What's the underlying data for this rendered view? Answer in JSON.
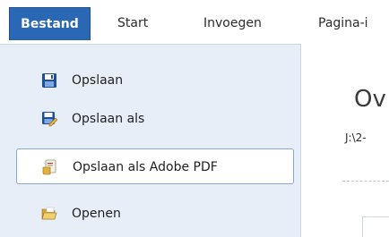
{
  "ribbon": {
    "tabs": {
      "file": "Bestand",
      "start": "Start",
      "insert": "Invoegen",
      "page_layout": "Pagina-i"
    }
  },
  "file_menu": {
    "items": [
      {
        "label": "Opslaan",
        "icon": "save-icon"
      },
      {
        "label": "Opslaan als",
        "icon": "save-as-icon"
      },
      {
        "label": "Opslaan als Adobe PDF",
        "icon": "adobe-pdf-icon",
        "selected": true
      },
      {
        "label": "Openen",
        "icon": "open-folder-icon"
      }
    ]
  },
  "info_panel": {
    "heading": "Ov",
    "path": "J:\\2-"
  },
  "colors": {
    "file_tab": "#2a67b4",
    "sidebar": "#e7eef8",
    "selected_border": "#87a7d6"
  }
}
